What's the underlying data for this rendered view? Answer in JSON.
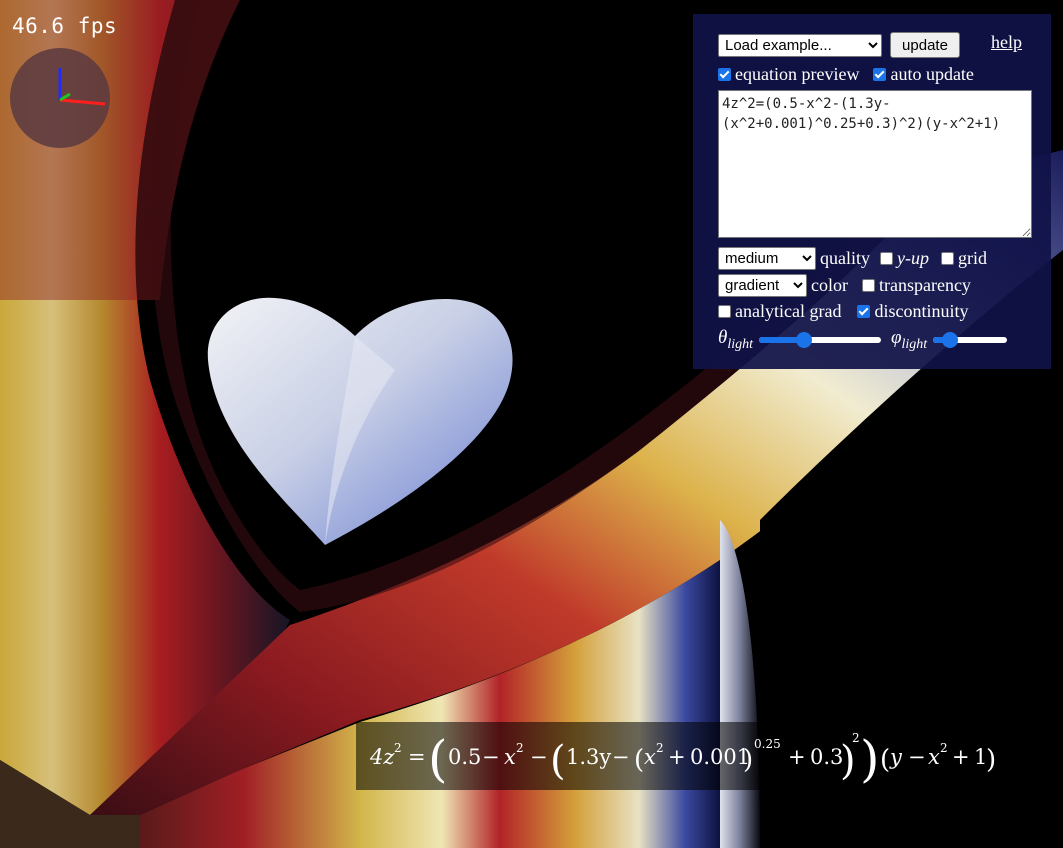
{
  "fps_text": "46.6 fps",
  "panel": {
    "example_select": "Load example...",
    "update_label": "update",
    "help_label": "help",
    "equation_preview_label": "equation preview",
    "equation_preview_checked": true,
    "auto_update_label": "auto update",
    "auto_update_checked": true,
    "equation_lines": [
      "4z^2=(0.5-x^2-(1.3y-",
      "(x^2+0.001)^0.25+0.3)^2)(y-",
      "x^2+1)"
    ],
    "quality_select": "medium",
    "quality_label": "quality",
    "yup_label": "y-up",
    "yup_checked": false,
    "grid_label": "grid",
    "grid_checked": false,
    "color_select": "gradient",
    "color_label": "color",
    "transparency_label": "transparency",
    "transparency_checked": false,
    "analytical_grad_label": "analytical grad",
    "analytical_grad_checked": false,
    "discontinuity_label": "discontinuity",
    "discontinuity_checked": true,
    "theta_symbol": "θ",
    "phi_symbol": "φ",
    "light_subscript": "light",
    "theta_value": 0.35,
    "phi_value": 0.15
  },
  "rendered_formula": {
    "lhs": "4z",
    "a": "0.5",
    "x": "x",
    "b": "1.3y",
    "c": "0.001",
    "exp1": "0.25",
    "d": "0.3",
    "two": "2",
    "y": "y",
    "one": "1"
  },
  "colors": {
    "panel_bg": "#101248",
    "accent": "#1a73e8",
    "heart": "#c9d2ea"
  }
}
